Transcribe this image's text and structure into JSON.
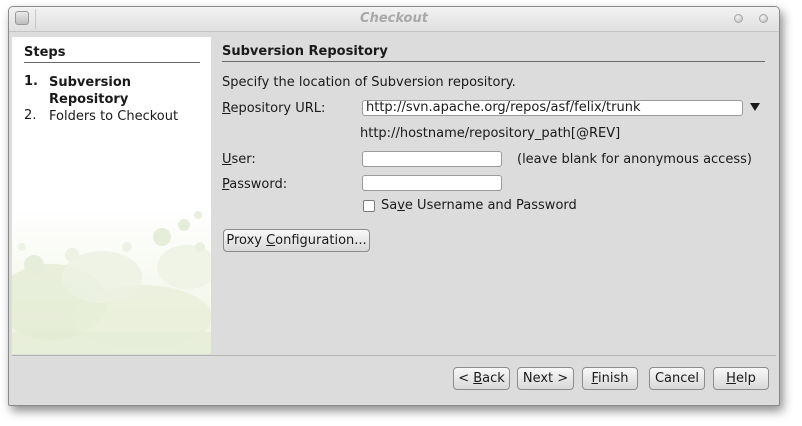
{
  "window": {
    "title": "Checkout"
  },
  "steps": {
    "heading": "Steps",
    "items": [
      {
        "number": "1.",
        "label": "Subversion Repository",
        "current": true
      },
      {
        "number": "2.",
        "label": "Folders to Checkout",
        "current": false
      }
    ]
  },
  "panel": {
    "title": "Subversion Repository",
    "description": "Specify the location of Subversion repository.",
    "repository_url": {
      "label": "Repository URL:",
      "mnemonic": "R",
      "value": "http://svn.apache.org/repos/asf/felix/trunk",
      "hint": "http://hostname/repository_path[@REV]"
    },
    "user": {
      "label": "User:",
      "mnemonic": "U",
      "value": "",
      "note": "(leave blank for anonymous access)"
    },
    "password": {
      "label": "Password:",
      "mnemonic": "P",
      "value": ""
    },
    "save_credentials": {
      "label": "Save Username and Password",
      "mnemonic": "v",
      "checked": false
    },
    "proxy_button": {
      "label": "Proxy Configuration...",
      "mnemonic": "C"
    }
  },
  "footer": {
    "back": {
      "label": "< Back",
      "mnemonic": "B"
    },
    "next": {
      "label": "Next >"
    },
    "finish": {
      "label": "Finish",
      "mnemonic": "F"
    },
    "cancel": {
      "label": "Cancel"
    },
    "help": {
      "label": "Help",
      "mnemonic": "H"
    }
  }
}
